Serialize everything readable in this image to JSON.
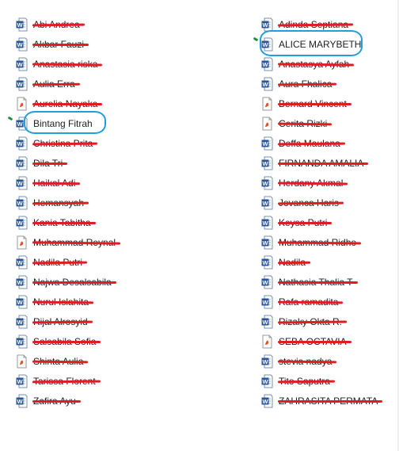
{
  "colors": {
    "strike": "#e01d24",
    "highlight": "#1fa0dc",
    "mark": "#1d8f3c",
    "word_icon": "#2b579a",
    "pdf_icon": "#e0542a"
  },
  "files_left": [
    {
      "name": "Abi Andrea",
      "icon": "word-icon",
      "struck": true
    },
    {
      "name": "Akbar Fauzi",
      "icon": "word-icon",
      "struck": true
    },
    {
      "name": "Anastasia riska",
      "icon": "word-icon",
      "struck": true
    },
    {
      "name": "Aulia Erra",
      "icon": "word-icon",
      "struck": true
    },
    {
      "name": "Aurelia Nayaka",
      "icon": "pdf-icon",
      "struck": true
    },
    {
      "name": "Bintang Fitrah",
      "icon": "word-icon",
      "struck": false,
      "highlighted": true
    },
    {
      "name": "Christina Prita",
      "icon": "word-icon",
      "struck": true
    },
    {
      "name": "Dila Tri",
      "icon": "word-icon",
      "struck": true
    },
    {
      "name": "Haikal Adi",
      "icon": "word-icon",
      "struck": true
    },
    {
      "name": "Hemansyah",
      "icon": "word-icon",
      "struck": true
    },
    {
      "name": "Kania Tabitha",
      "icon": "word-icon",
      "struck": true
    },
    {
      "name": "Muhammad Reynal",
      "icon": "pdf-icon",
      "struck": true
    },
    {
      "name": "Nadila Putri",
      "icon": "word-icon",
      "struck": true
    },
    {
      "name": "Najwa Desalsabila",
      "icon": "word-icon",
      "struck": true
    },
    {
      "name": "Nurul Islahita",
      "icon": "word-icon",
      "struck": true
    },
    {
      "name": "Rijal Alrosyid",
      "icon": "word-icon",
      "struck": true
    },
    {
      "name": "Salsabila Sofia",
      "icon": "word-icon",
      "struck": true
    },
    {
      "name": "Shinta Aulia",
      "icon": "pdf-icon",
      "struck": true
    },
    {
      "name": "Tarissa Florent",
      "icon": "word-icon",
      "struck": true
    },
    {
      "name": "Zafira Ayu",
      "icon": "word-icon",
      "struck": true
    }
  ],
  "files_right": [
    {
      "name": "Adinda Septiana",
      "icon": "word-icon",
      "struck": true
    },
    {
      "name": "ALICE MARYBETH",
      "icon": "word-icon",
      "struck": false,
      "highlighted": true
    },
    {
      "name": "Anastasya Ayfah",
      "icon": "word-icon",
      "struck": true
    },
    {
      "name": "Aura Fhalica",
      "icon": "word-icon",
      "struck": true
    },
    {
      "name": "Bernard Vincent",
      "icon": "pdf-icon",
      "struck": true
    },
    {
      "name": "Cerita Rizki",
      "icon": "pdf-icon",
      "struck": true
    },
    {
      "name": "Deffa Maulana",
      "icon": "word-icon",
      "struck": true
    },
    {
      "name": "FIRNANDA AMALIA",
      "icon": "word-icon",
      "struck": true
    },
    {
      "name": "Herdany Akmal",
      "icon": "word-icon",
      "struck": true
    },
    {
      "name": "Jovanca Haris",
      "icon": "word-icon",
      "struck": true
    },
    {
      "name": "Keysa Putri",
      "icon": "word-icon",
      "struck": true
    },
    {
      "name": "Muhammad Ridho",
      "icon": "word-icon",
      "struck": true
    },
    {
      "name": "Nadila",
      "icon": "word-icon",
      "struck": true
    },
    {
      "name": "Nathasia Thalia T",
      "icon": "word-icon",
      "struck": true
    },
    {
      "name": "Rafa ramadita",
      "icon": "word-icon",
      "struck": true
    },
    {
      "name": "Rizaky Okta R.",
      "icon": "word-icon",
      "struck": true
    },
    {
      "name": "SEBA OCTAVIA",
      "icon": "pdf-icon",
      "struck": true
    },
    {
      "name": "stevia nadya",
      "icon": "word-icon",
      "struck": true
    },
    {
      "name": "Tito Saputra",
      "icon": "word-icon",
      "struck": true
    },
    {
      "name": "ZAHRASITA PERMATA",
      "icon": "word-icon",
      "struck": true
    }
  ]
}
